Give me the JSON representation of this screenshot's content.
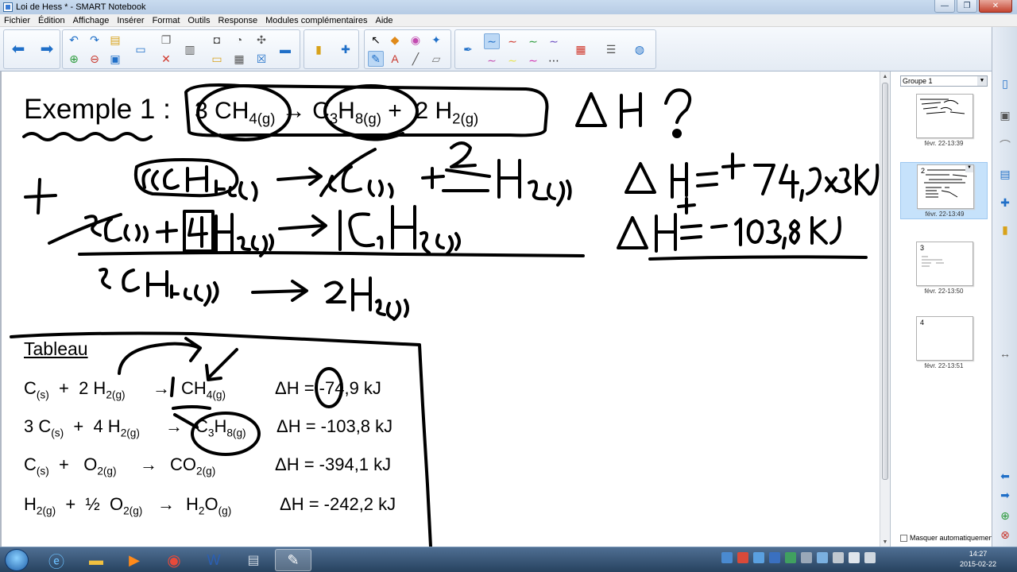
{
  "window": {
    "title": "Loi de Hess * - SMART Notebook",
    "controls": {
      "minimize": "—",
      "maximize": "❐",
      "close": "✕"
    }
  },
  "menu": [
    "Fichier",
    "Édition",
    "Affichage",
    "Insérer",
    "Format",
    "Outils",
    "Response",
    "Modules complémentaires",
    "Aide"
  ],
  "page": {
    "example_title": "Exemple 1 :",
    "equation": {
      "c1": "3",
      "r1": "CH",
      "r1_sub": "4(g)",
      "arrow": "→",
      "p1": "C",
      "p1_sub3": "3",
      "p1_h": "H",
      "p1_sub": "8(g)",
      "plus": "+",
      "c2": "2",
      "p2": "H",
      "p2_sub": "2(g)"
    },
    "table_title": "Tableau",
    "table_rows": [
      {
        "lhs": "C(s)  +  2 H2(g)",
        "arrow": "→",
        "rhs": "CH4(g)",
        "dh": "ΔH = -74,9 kJ"
      },
      {
        "lhs": "3 C(s)  +  4 H2(g)",
        "arrow": "→",
        "rhs": "C3H8(g)",
        "dh": "ΔH = -103,8 kJ"
      },
      {
        "lhs": "C(s)  +   O2(g)",
        "arrow": "→",
        "rhs": "CO2(g)",
        "dh": "ΔH = -394,1 kJ"
      },
      {
        "lhs": "H2(g)  +  ½  O2(g)",
        "arrow": "→",
        "rhs": "H2O(g)",
        "dh": "ΔH = -242,2 kJ"
      }
    ]
  },
  "sorter": {
    "group": "Groupe 1",
    "pages": [
      {
        "num": "",
        "date": "févr. 22-13:39"
      },
      {
        "num": "2",
        "date": "févr. 22-13:49"
      },
      {
        "num": "3",
        "date": "févr. 22-13:50"
      },
      {
        "num": "4",
        "date": "févr. 22-13:51"
      }
    ],
    "hide_auto": "Masquer automatiquement"
  },
  "clock": {
    "time": "14:27",
    "date": "2015-02-22"
  },
  "colors": {
    "accent": "#1f5fa8",
    "current_page": "#c6e2fb",
    "ink": "#000000"
  }
}
